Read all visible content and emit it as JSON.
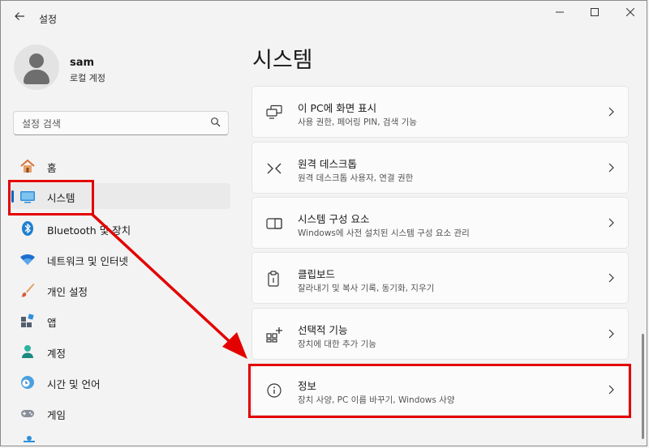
{
  "window": {
    "back_icon": "arrow-left-icon",
    "title": "설정",
    "minimize": "—",
    "maximize": "☐",
    "close": "✕"
  },
  "user": {
    "name": "sam",
    "account_type": "로컬 계정"
  },
  "search": {
    "placeholder": "설정 검색"
  },
  "nav": {
    "items": [
      {
        "label": "홈",
        "icon": "home-icon"
      },
      {
        "label": "시스템",
        "icon": "system-monitor-icon",
        "selected": true
      },
      {
        "label": "Bluetooth 및 장치",
        "icon": "bluetooth-icon"
      },
      {
        "label": "네트워크 및 인터넷",
        "icon": "wifi-icon"
      },
      {
        "label": "개인 설정",
        "icon": "brush-icon"
      },
      {
        "label": "앱",
        "icon": "apps-icon"
      },
      {
        "label": "계정",
        "icon": "account-icon"
      },
      {
        "label": "시간 및 언어",
        "icon": "clock-globe-icon"
      },
      {
        "label": "게임",
        "icon": "gamepad-icon"
      }
    ]
  },
  "main": {
    "title": "시스템",
    "cards": [
      {
        "title": "이 PC에 화면 표시",
        "subtitle": "사용 권한, 페어링 PIN, 검색 기능",
        "icon": "project-to-pc-icon"
      },
      {
        "title": "원격 데스크톱",
        "subtitle": "원격 데스크톱 사용자, 연결 권한",
        "icon": "remote-desktop-icon"
      },
      {
        "title": "시스템 구성 요소",
        "subtitle": "Windows에 사전 설치된 시스템 구성 요소 관리",
        "icon": "system-components-icon"
      },
      {
        "title": "클립보드",
        "subtitle": "잘라내기 및 복사 기록, 동기화, 지우기",
        "icon": "clipboard-icon"
      },
      {
        "title": "선택적 기능",
        "subtitle": "장치에 대한 추가 기능",
        "icon": "optional-features-icon"
      },
      {
        "title": "정보",
        "subtitle": "장치 사양, PC 이름 바꾸기, Windows 사양",
        "icon": "info-icon"
      }
    ]
  },
  "colors": {
    "accent": "#0067c0",
    "highlight": "#e30000"
  }
}
